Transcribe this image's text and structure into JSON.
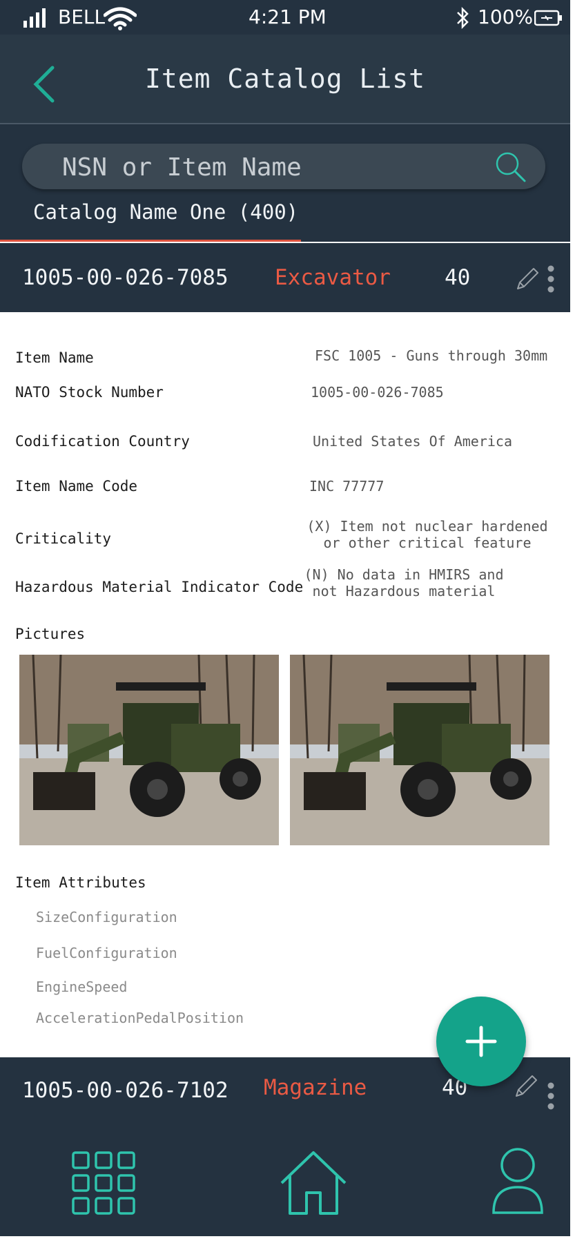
{
  "status_bar": {
    "carrier": "BELL",
    "time": "4:21 PM",
    "battery": "100%"
  },
  "header": {
    "title": "Item Catalog List"
  },
  "search": {
    "placeholder": "NSN or Item Name"
  },
  "catalog_tab": {
    "label": "Catalog Name One (400)"
  },
  "colors": {
    "header_bg": "#2a3946",
    "dark_bg": "#243240",
    "accent_red": "#ea5a44",
    "accent_teal": "#2fc4ad",
    "fab": "#14a38a"
  },
  "items": [
    {
      "nsn": "1005-00-026-7085",
      "name": "Excavator",
      "qty": "40"
    },
    {
      "nsn": "1005-00-026-7102",
      "name": "Magazine",
      "qty": "40"
    }
  ],
  "details": {
    "item_name_label": "Item Name",
    "item_name_value": "FSC 1005 - Guns through 30mm",
    "nsn_label": "NATO Stock Number",
    "nsn_value": "1005-00-026-7085",
    "country_label": "Codification Country",
    "country_value": "United States Of America",
    "inc_label": "Item Name Code",
    "inc_value": "INC 77777",
    "criticality_label": "Criticality",
    "criticality_value_line1": "(X) Item not nuclear hardened",
    "criticality_value_line2": "or other critical feature",
    "hazmat_label": "Hazardous Material Indicator Code",
    "hazmat_value_line1": "(N) No data in HMIRS and",
    "hazmat_value_line2": "not Hazardous material",
    "pictures_label": "Pictures",
    "attributes_label": "Item Attributes",
    "attributes": [
      "SizeConfiguration",
      "FuelConfiguration",
      "EngineSpeed",
      "AccelerationPedalPosition"
    ]
  },
  "icons": {
    "back": "chevron-left-icon",
    "search": "search-icon",
    "edit": "pencil-icon",
    "more": "more-vertical-icon",
    "fab": "plus-icon",
    "nav": [
      "grid-icon",
      "home-icon",
      "user-icon"
    ]
  }
}
